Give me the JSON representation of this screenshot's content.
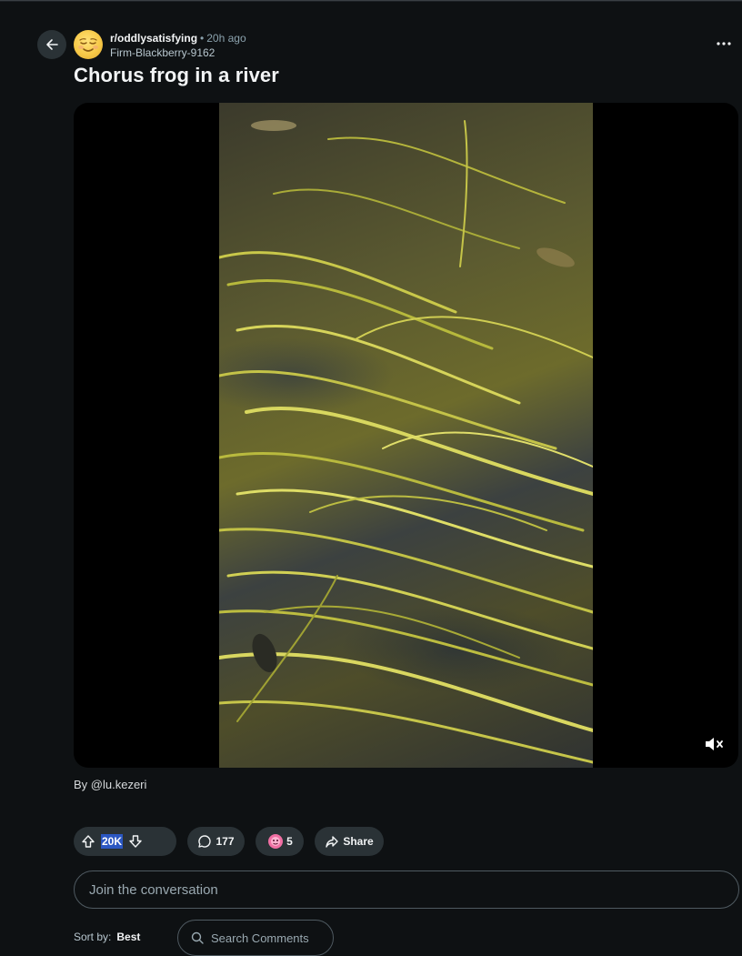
{
  "post": {
    "subreddit": "r/oddlysatisfying",
    "separator": "•",
    "time": "20h ago",
    "author": "Firm-Blackberry-9162",
    "title": "Chorus frog in a river",
    "credit": "By @lu.kezeri"
  },
  "actions": {
    "score": "20K",
    "comments": "177",
    "awards": "5",
    "share_label": "Share"
  },
  "comment_box": {
    "placeholder": "Join the conversation"
  },
  "sort": {
    "label": "Sort by:",
    "value": "Best"
  },
  "search_comments": {
    "placeholder": "Search Comments"
  },
  "icons": {
    "back": "arrow-left-icon",
    "more": "more-horizontal-icon",
    "mute": "speaker-muted-icon",
    "upvote": "upvote-arrow-icon",
    "downvote": "downvote-arrow-icon",
    "comment": "comment-bubble-icon",
    "award": "award-icon",
    "share": "share-arrow-icon",
    "search": "search-icon"
  },
  "colors": {
    "background": "#0e1113",
    "button": "#2a3236",
    "score_highlight": "#2b57c2"
  }
}
